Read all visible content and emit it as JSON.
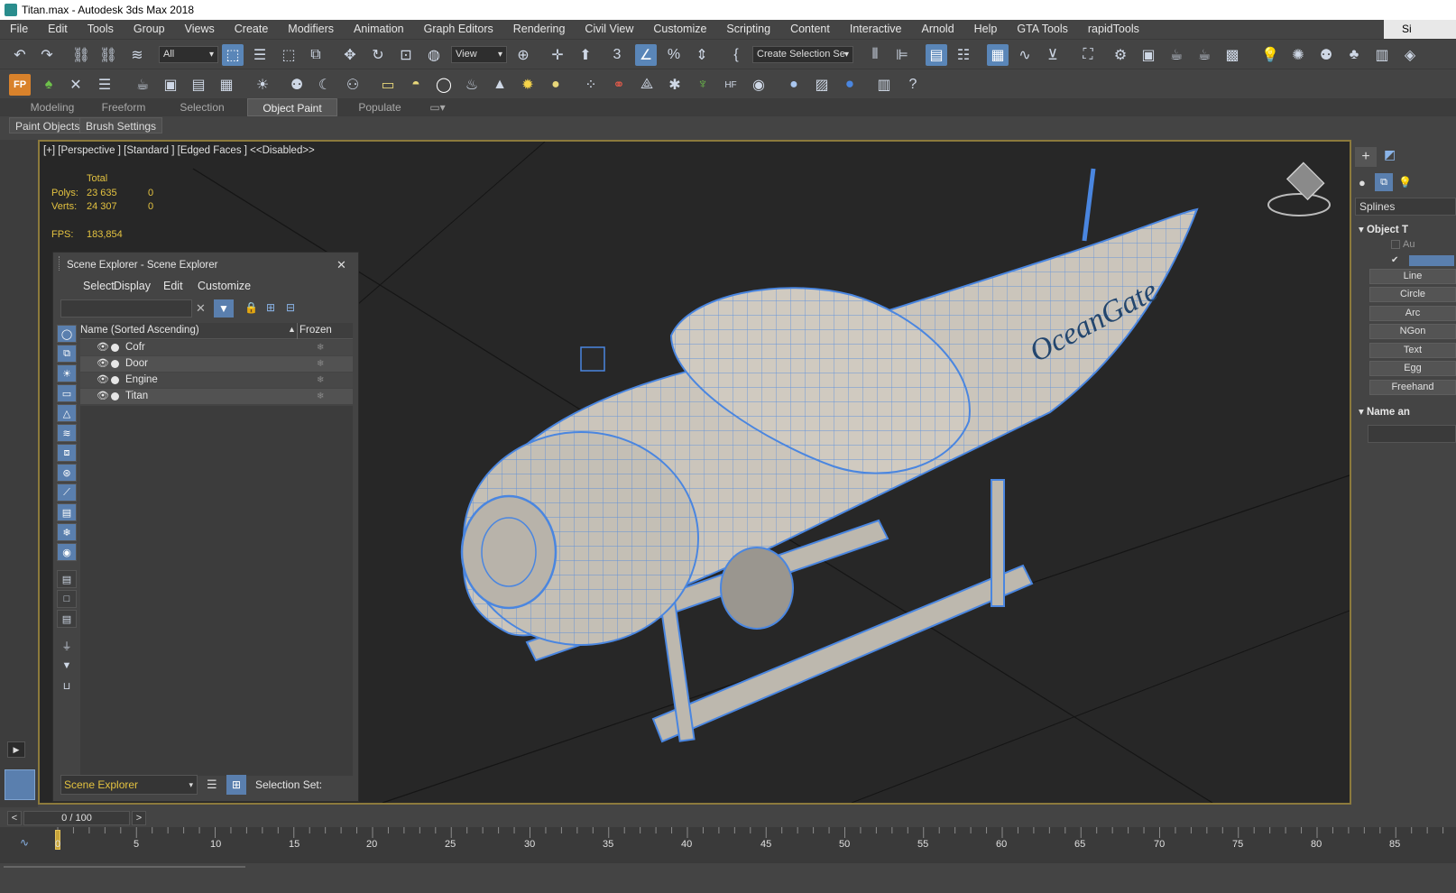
{
  "window": {
    "title": "Titan.max - Autodesk 3ds Max 2018",
    "sign_in": "Si"
  },
  "menu": [
    "File",
    "Edit",
    "Tools",
    "Group",
    "Views",
    "Create",
    "Modifiers",
    "Animation",
    "Graph Editors",
    "Rendering",
    "Civil View",
    "Customize",
    "Scripting",
    "Content",
    "Interactive",
    "Arnold",
    "Help",
    "GTA Tools",
    "rapidTools"
  ],
  "toolbar": {
    "filter_dropdown": "All",
    "view_dropdown": "View",
    "selection_set_dropdown": "Create Selection Se"
  },
  "ribbon": {
    "tabs": [
      "Modeling",
      "Freeform",
      "Selection",
      "Object Paint",
      "Populate"
    ],
    "active_tab": "Object Paint",
    "sub_buttons": [
      "Paint Objects",
      "Brush Settings"
    ]
  },
  "viewport": {
    "label": "[+] [Perspective ] [Standard ] [Edged Faces ]  <<Disabled>>",
    "stats_header": "Total",
    "polys_label": "Polys:",
    "polys_value": "23 635",
    "polys_sel": "0",
    "verts_label": "Verts:",
    "verts_value": "24 307",
    "verts_sel": "0",
    "fps_label": "FPS:",
    "fps_value": "183,854",
    "logo_text": "OceanGate",
    "accent_color": "#4a86e0",
    "hull_color": "#c8c2b8"
  },
  "scene_explorer": {
    "title": "Scene Explorer - Scene Explorer",
    "menu": [
      "Select",
      "Display",
      "Edit",
      "Customize"
    ],
    "col_name": "Name (Sorted Ascending)",
    "col_frozen": "Frozen",
    "rows": [
      {
        "name": "Cofr"
      },
      {
        "name": "Door"
      },
      {
        "name": "Engine"
      },
      {
        "name": "Titan"
      }
    ],
    "footer_dropdown": "Scene Explorer",
    "selection_set_label": "Selection Set:"
  },
  "command_panel": {
    "category": "Splines",
    "rollout_object_type": "Object T",
    "autogrid": "Au",
    "buttons": [
      "Line",
      "Circle",
      "Arc",
      "NGon",
      "Text",
      "Egg",
      "Freehand"
    ],
    "rollout_name": "Name an"
  },
  "timeline": {
    "frame_display": "0 / 100",
    "ticks": [
      "0",
      "5",
      "10",
      "15",
      "20",
      "25",
      "30",
      "35",
      "40",
      "45",
      "50",
      "55",
      "60",
      "65",
      "70",
      "75",
      "80",
      "85"
    ]
  }
}
